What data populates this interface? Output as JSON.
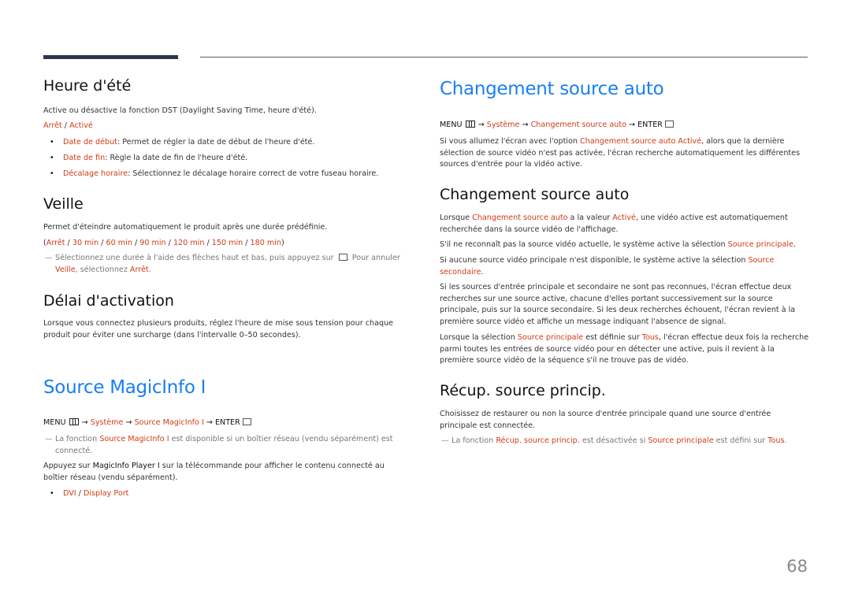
{
  "page_number": "68",
  "left": {
    "heure_ete": {
      "title": "Heure d'été",
      "description": "Active ou désactive la fonction DST (Daylight Saving Time, heure d'été).",
      "options": [
        "Arrêt",
        "Activé"
      ],
      "bullets": [
        {
          "term": "Date de début",
          "text": ": Permet de régler la date de début de l'heure d'été."
        },
        {
          "term": "Date de fin",
          "text": ": Règle la date de fin de l'heure d'été."
        },
        {
          "term": "Décalage horaire",
          "text": ": Sélectionnez le décalage horaire correct de votre fuseau horaire."
        }
      ]
    },
    "veille": {
      "title": "Veille",
      "description": "Permet d'éteindre automatiquement le produit après une durée prédéfinie.",
      "options": [
        "Arrêt",
        "30 min",
        "60 min",
        "90 min",
        "120 min",
        "150 min",
        "180 min"
      ],
      "note_part1": "Sélectionnez une durée à l'aide des flèches haut et bas, puis appuyez sur ",
      "note_part2": ". Pour annuler ",
      "note_hl1": "Veille",
      "note_part3": ", sélectionnez ",
      "note_hl2": "Arrêt",
      "note_part4": "."
    },
    "delai": {
      "title": "Délai d'activation",
      "description": "Lorsque vous connectez plusieurs produits, réglez l'heure de mise sous tension pour chaque produit pour éviter une surcharge (dans l'intervalle 0–50 secondes)."
    },
    "magicinfo": {
      "title": "Source MagicInfo I",
      "menu": "MENU",
      "path1": "Système",
      "path2": "Source MagicInfo I",
      "enter": "ENTER",
      "note_part1": "La fonction ",
      "note_hl": "Source MagicInfo I",
      "note_part2": " est disponible si un boîtier réseau (vendu séparément) est connecté.",
      "para_part1": "Appuyez sur ",
      "para_bold": "MagicInfo Player I",
      "para_part2": " sur la télécommande pour afficher le contenu connecté au boîtier réseau (vendu séparément).",
      "bullet_options": [
        "DVI",
        "Display Port"
      ]
    }
  },
  "right": {
    "changement": {
      "title": "Changement source auto",
      "menu": "MENU",
      "path1": "Système",
      "path2": "Changement source auto",
      "enter": "ENTER",
      "para_part1": "Si vous allumez l'écran avec l'option ",
      "para_hl": "Changement source auto Activé",
      "para_part2": ", alors que la dernière sélection de source vidéo n'est pas activée, l'écran recherche automatiquement les différentes sources d'entrée pour la vidéo active."
    },
    "changement_sub": {
      "title": "Changement source auto",
      "p1_a": "Lorsque ",
      "p1_hl1": "Changement source auto",
      "p1_b": " a la valeur ",
      "p1_hl2": "Activé",
      "p1_c": ", une vidéo active est automatiquement recherchée dans la source vidéo de l'affichage.",
      "p2_a": "S'il ne reconnaît pas la source vidéo actuelle, le système active la sélection ",
      "p2_hl": "Source principale",
      "p2_b": ".",
      "p3_a": "Si aucune source vidéo principale n'est disponible, le système active la sélection ",
      "p3_hl": "Source secondaire",
      "p3_b": ".",
      "p4": "Si les sources d'entrée principale et secondaire ne sont pas reconnues, l'écran effectue deux recherches sur une source active, chacune d'elles portant successivement sur la source principale, puis sur la source secondaire. Si les deux recherches échouent, l'écran revient à la première source vidéo et affiche un message indiquant l'absence de signal.",
      "p5_a": "Lorsque la sélection ",
      "p5_hl1": "Source principale",
      "p5_b": " est définie sur ",
      "p5_hl2": "Tous",
      "p5_c": ", l'écran effectue deux fois la recherche parmi toutes les entrées de source vidéo pour en détecter une active, puis il revient à la première source vidéo de la séquence s'il ne trouve pas de vidéo."
    },
    "recup": {
      "title": "Récup. source princip.",
      "description": "Choisissez de restaurer ou non la source d'entrée principale quand une source d'entrée principale est connectée.",
      "note_a": "La fonction ",
      "note_hl1": "Récup. source princip.",
      "note_b": " est désactivée si ",
      "note_hl2": "Source principale",
      "note_c": " est défini sur ",
      "note_hl3": "Tous",
      "note_d": "."
    }
  }
}
